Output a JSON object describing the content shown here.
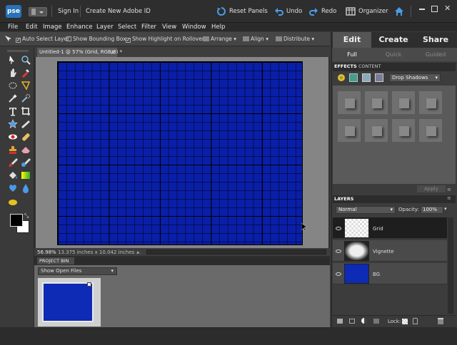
{
  "app": {
    "logo": "pse",
    "sign_in": "Sign In",
    "create_id": "Create New Adobe ID"
  },
  "toolbar": {
    "reset_panels": "Reset Panels",
    "undo": "Undo",
    "redo": "Redo",
    "organizer": "Organizer"
  },
  "menus": [
    "File",
    "Edit",
    "Image",
    "Enhance",
    "Layer",
    "Select",
    "Filter",
    "View",
    "Window",
    "Help"
  ],
  "options": {
    "auto_select": "Auto Select Layer",
    "show_bounding": "Show Bounding Box",
    "show_highlight": "Show Highlight on Rollover",
    "arrange": "Arrange",
    "align": "Align",
    "distribute": "Distribute"
  },
  "document": {
    "tab_label": "Untitled-1 @ 57% (Grid, RGB/8) *",
    "close": "×",
    "zoom": "56.98%",
    "size_info": "13.375 inches x 10.042 inches ..."
  },
  "project_bin": {
    "title": "PROJECT BIN",
    "show_select": "Show Open Files"
  },
  "panel_tabs": {
    "edit": "Edit",
    "create": "Create",
    "share": "Share"
  },
  "edit_modes": {
    "full": "Full",
    "quick": "Quick",
    "guided": "Guided"
  },
  "effects": {
    "tab_effects": "EFFECTS",
    "tab_content": "CONTENT",
    "dropdown": "Drop Shadows",
    "apply": "Apply"
  },
  "layers": {
    "title": "LAYERS",
    "blend_mode": "Normal",
    "opacity_label": "Opacity:",
    "opacity_value": "100%",
    "items": [
      {
        "name": "Grid"
      },
      {
        "name": "Vignette"
      },
      {
        "name": "BG"
      }
    ],
    "lock_label": "Lock:"
  },
  "colors": {
    "canvas_blue": "#0a1fa8",
    "accent_blue": "#2a72b8"
  }
}
